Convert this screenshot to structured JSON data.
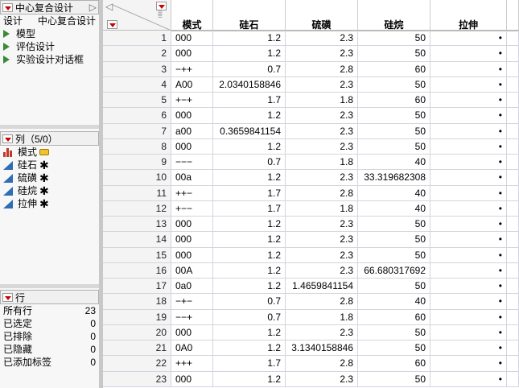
{
  "design_panel": {
    "title": "中心复合设计",
    "design_label": "设计",
    "design_value": "中心复合设计",
    "scripts": [
      "模型",
      "评估设计",
      "实验设计对话框"
    ]
  },
  "columns_panel": {
    "title": "列（5/0）",
    "columns": [
      {
        "name": "模式",
        "type": "nominal"
      },
      {
        "name": "硅石",
        "type": "continuous"
      },
      {
        "name": "硫磺",
        "type": "continuous"
      },
      {
        "name": "硅烷",
        "type": "continuous"
      },
      {
        "name": "拉伸",
        "type": "continuous"
      }
    ]
  },
  "rows_panel": {
    "title": "行",
    "items": [
      {
        "label": "所有行",
        "value": "23"
      },
      {
        "label": "已选定",
        "value": "0"
      },
      {
        "label": "已排除",
        "value": "0"
      },
      {
        "label": "已隐藏",
        "value": "0"
      },
      {
        "label": "已添加标签",
        "value": "0"
      }
    ]
  },
  "table": {
    "headers": [
      "模式",
      "硅石",
      "硫磺",
      "硅烷",
      "拉伸"
    ],
    "rows": [
      [
        "1",
        "000",
        "1.2",
        "2.3",
        "50",
        "•"
      ],
      [
        "2",
        "000",
        "1.2",
        "2.3",
        "50",
        "•"
      ],
      [
        "3",
        "−++",
        "0.7",
        "2.8",
        "60",
        "•"
      ],
      [
        "4",
        "A00",
        "2.0340158846",
        "2.3",
        "50",
        "•"
      ],
      [
        "5",
        "+−+",
        "1.7",
        "1.8",
        "60",
        "•"
      ],
      [
        "6",
        "000",
        "1.2",
        "2.3",
        "50",
        "•"
      ],
      [
        "7",
        "a00",
        "0.3659841154",
        "2.3",
        "50",
        "•"
      ],
      [
        "8",
        "000",
        "1.2",
        "2.3",
        "50",
        "•"
      ],
      [
        "9",
        "−−−",
        "0.7",
        "1.8",
        "40",
        "•"
      ],
      [
        "10",
        "00a",
        "1.2",
        "2.3",
        "33.319682308",
        "•"
      ],
      [
        "11",
        "++−",
        "1.7",
        "2.8",
        "40",
        "•"
      ],
      [
        "12",
        "+−−",
        "1.7",
        "1.8",
        "40",
        "•"
      ],
      [
        "13",
        "000",
        "1.2",
        "2.3",
        "50",
        "•"
      ],
      [
        "14",
        "000",
        "1.2",
        "2.3",
        "50",
        "•"
      ],
      [
        "15",
        "000",
        "1.2",
        "2.3",
        "50",
        "•"
      ],
      [
        "16",
        "00A",
        "1.2",
        "2.3",
        "66.680317692",
        "•"
      ],
      [
        "17",
        "0a0",
        "1.2",
        "1.4659841154",
        "50",
        "•"
      ],
      [
        "18",
        "−+−",
        "0.7",
        "2.8",
        "40",
        "•"
      ],
      [
        "19",
        "−−+",
        "0.7",
        "1.8",
        "60",
        "•"
      ],
      [
        "20",
        "000",
        "1.2",
        "2.3",
        "50",
        "•"
      ],
      [
        "21",
        "0A0",
        "1.2",
        "3.1340158846",
        "50",
        "•"
      ],
      [
        "22",
        "+++",
        "1.7",
        "2.8",
        "60",
        "•"
      ],
      [
        "23",
        "000",
        "1.2",
        "2.3",
        "50",
        "•"
      ]
    ]
  }
}
